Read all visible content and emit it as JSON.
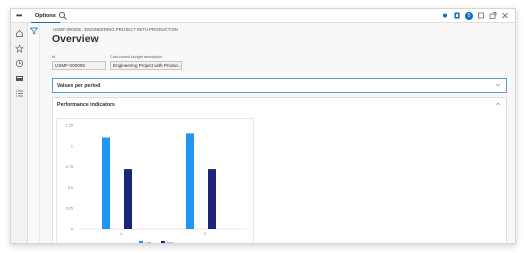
{
  "topbar": {
    "options_label": "Options",
    "notification_count": "0",
    "icons": [
      "menu-dots-icon",
      "search-icon",
      "connect-icon",
      "office-icon",
      "notification-icon",
      "restore-icon",
      "open-new-window-icon",
      "close-icon"
    ]
  },
  "sidebar": {
    "icons": [
      "home-icon",
      "star-icon",
      "clock-icon",
      "workspace-icon",
      "list-icon"
    ]
  },
  "breadcrumb": "USMF-000005 : ENGINEERING PROJECT WITH PRODUCTION",
  "page_title": "Overview",
  "fields": {
    "id_label": "Id",
    "id_value": "USMF-000005",
    "cost_label": "Cost control budget description",
    "cost_value": "Engineering Project with Produc..."
  },
  "sections": {
    "values_per_period": "Values per period",
    "performance_indicators": "Performance indicators"
  },
  "chart_data": {
    "type": "bar",
    "categories": [
      "1",
      "2"
    ],
    "series": [
      {
        "name": "CPI",
        "values": [
          1.1,
          1.15
        ],
        "color": "#2196f3"
      },
      {
        "name": "SPI",
        "values": [
          0.72,
          0.72
        ],
        "color": "#1a237e"
      }
    ],
    "ylim": [
      0,
      1.25
    ],
    "yticks": [
      "0",
      "0.25",
      "0.5",
      "0.75",
      "1",
      "1.25"
    ],
    "legend": "bottom"
  }
}
